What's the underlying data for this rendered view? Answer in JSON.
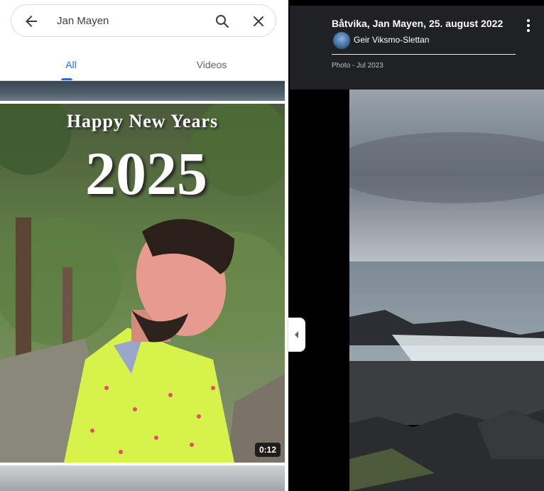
{
  "search": {
    "query": "Jan Mayen"
  },
  "tabs": [
    {
      "label": "All",
      "active": true
    },
    {
      "label": "Videos",
      "active": false
    }
  ],
  "video": {
    "title_line1": "Happy New Years",
    "title_line2": "2025",
    "duration": "0:12"
  },
  "photo_info": {
    "title": "Båtvika, Jan Mayen, 25. august 2022",
    "author": "Geir Viksmo-Slettan",
    "meta": "Photo - Jul 2023"
  },
  "colors": {
    "accent": "#1a73e8",
    "info_bg": "#202124"
  },
  "icons": {
    "back": "arrow-left",
    "search": "magnifier",
    "clear": "x",
    "collapse": "chevron-left",
    "more": "vertical-dots"
  }
}
